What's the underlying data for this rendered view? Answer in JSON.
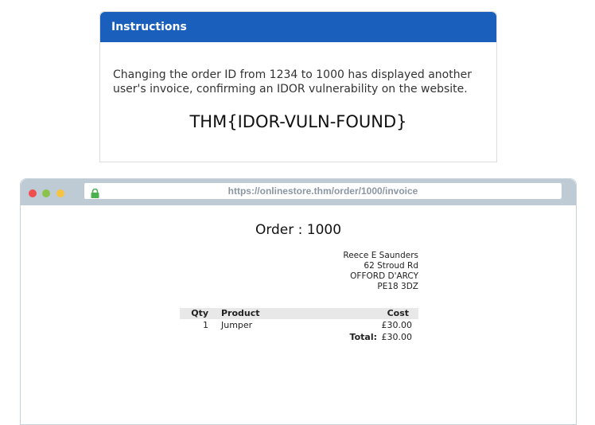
{
  "instructions": {
    "header": "Instructions",
    "text": "Changing the order ID from 1234 to 1000 has displayed another user's invoice, confirming an IDOR vulnerability on the website.",
    "flag": "THM{IDOR-VULN-FOUND}"
  },
  "browser": {
    "url": "https://onlinestore.thm/order/1000/invoice",
    "lock_color": "#4caf50"
  },
  "invoice": {
    "title": "Order : 1000",
    "address": {
      "name": "Reece E Saunders",
      "street": "62 Stroud Rd",
      "city": "OFFORD D'ARCY",
      "postcode": "PE18 3DZ"
    },
    "headers": {
      "qty": "Qty",
      "product": "Product",
      "cost": "Cost"
    },
    "items": [
      {
        "qty": "1",
        "product": "Jumper",
        "cost": "£30.00"
      }
    ],
    "total_label": "Total:",
    "total_value": "£30.00"
  },
  "colors": {
    "header_blue": "#1b5fbd",
    "browser_chrome": "#bfcbd4"
  }
}
